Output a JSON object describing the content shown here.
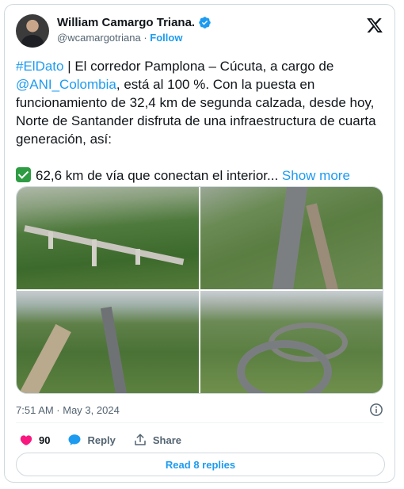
{
  "author": {
    "display_name": "William Camargo Triana.",
    "handle": "@wcamargotriana",
    "separator": "·",
    "follow_label": "Follow"
  },
  "tweet": {
    "hashtag": "#ElDato",
    "text_1": " | El corredor Pamplona – Cúcuta, a cargo de ",
    "mention": "@ANI_Colombia",
    "text_2": ", está al 100 %.  Con la puesta en funcionamiento de 32,4 km de segunda calzada, desde hoy, Norte de Santander disfruta de una infraestructura de cuarta generación, así:",
    "line_2": "62,6 km de vía que conectan el interior...",
    "show_more": "Show more"
  },
  "media": {
    "photos": [
      "bridge-viaduct",
      "highway-toll-plaza",
      "highway-valley",
      "road-interchange"
    ]
  },
  "timestamp": "7:51 AM · May 3, 2024",
  "actions": {
    "likes_count": "90",
    "reply_label": "Reply",
    "share_label": "Share"
  },
  "read_replies_label": "Read 8 replies",
  "colors": {
    "accent": "#1d9bf0",
    "like": "#f91880",
    "text": "#0f1419",
    "muted": "#536471"
  }
}
